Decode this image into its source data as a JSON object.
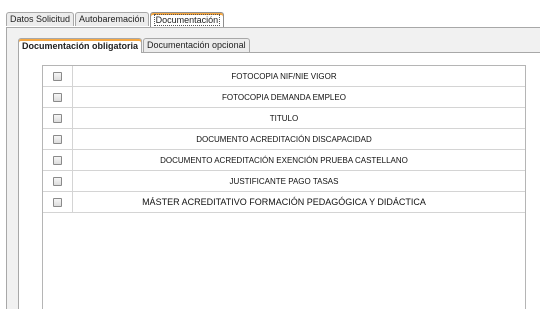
{
  "outer_tabs": [
    {
      "label": "Datos Solicitud"
    },
    {
      "label": "Autobaremación"
    },
    {
      "label": "Documentación"
    }
  ],
  "inner_tabs": [
    {
      "label": "Documentación obligatoria"
    },
    {
      "label": "Documentación opcional"
    }
  ],
  "documents": [
    {
      "label": "FOTOCOPIA NIF/NIE VIGOR",
      "checked": false
    },
    {
      "label": "FOTOCOPIA DEMANDA EMPLEO",
      "checked": false
    },
    {
      "label": "TITULO",
      "checked": false
    },
    {
      "label": "DOCUMENTO ACREDITACIÓN DISCAPACIDAD",
      "checked": false
    },
    {
      "label": "DOCUMENTO ACREDITACIÓN EXENCIÓN PRUEBA CASTELLANO",
      "checked": false
    },
    {
      "label": "JUSTIFICANTE PAGO TASAS",
      "checked": false
    },
    {
      "label": "MÁSTER ACREDITATIVO FORMACIÓN PEDAGÓGICA Y DIDÁCTICA",
      "checked": false
    }
  ]
}
